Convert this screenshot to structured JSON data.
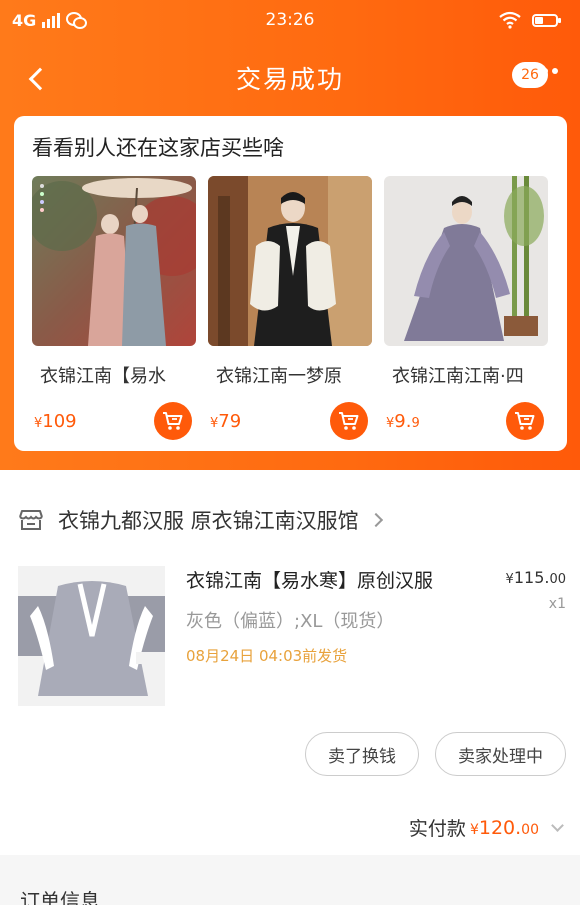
{
  "status_bar": {
    "network": "4G",
    "time": "23:26"
  },
  "nav": {
    "title": "交易成功",
    "message_count": "26"
  },
  "recommend": {
    "title": "看看别人还在这家店买些啥",
    "items": [
      {
        "name": "衣锦江南【易水",
        "price_symbol": "¥",
        "price_main": "109",
        "price_decimal": ""
      },
      {
        "name": "衣锦江南一梦原",
        "price_symbol": "¥",
        "price_main": "79",
        "price_decimal": ""
      },
      {
        "name": "衣锦江南江南·四",
        "price_symbol": "¥",
        "price_main": "9.",
        "price_decimal": "9"
      }
    ]
  },
  "order": {
    "shop_name": "衣锦九都汉服 原衣锦江南汉服馆",
    "product": {
      "title": "衣锦江南【易水寒】原创汉服",
      "spec": "灰色（偏蓝）;XL（现货）",
      "ship_time": "08月24日 04:03前发货",
      "price_symbol": "¥",
      "price_main": "115.",
      "price_decimal": "00",
      "quantity": "x1"
    },
    "actions": [
      "卖了换钱",
      "卖家处理中"
    ],
    "paid_label": "实付款",
    "paid_symbol": "¥",
    "paid_main": "120.",
    "paid_decimal": "00",
    "next_section_peek": "订单信息"
  },
  "colors": {
    "accent": "#ff5a0a",
    "header_gradient_start": "#ff7a1a",
    "ship_text": "#e8a23c"
  }
}
